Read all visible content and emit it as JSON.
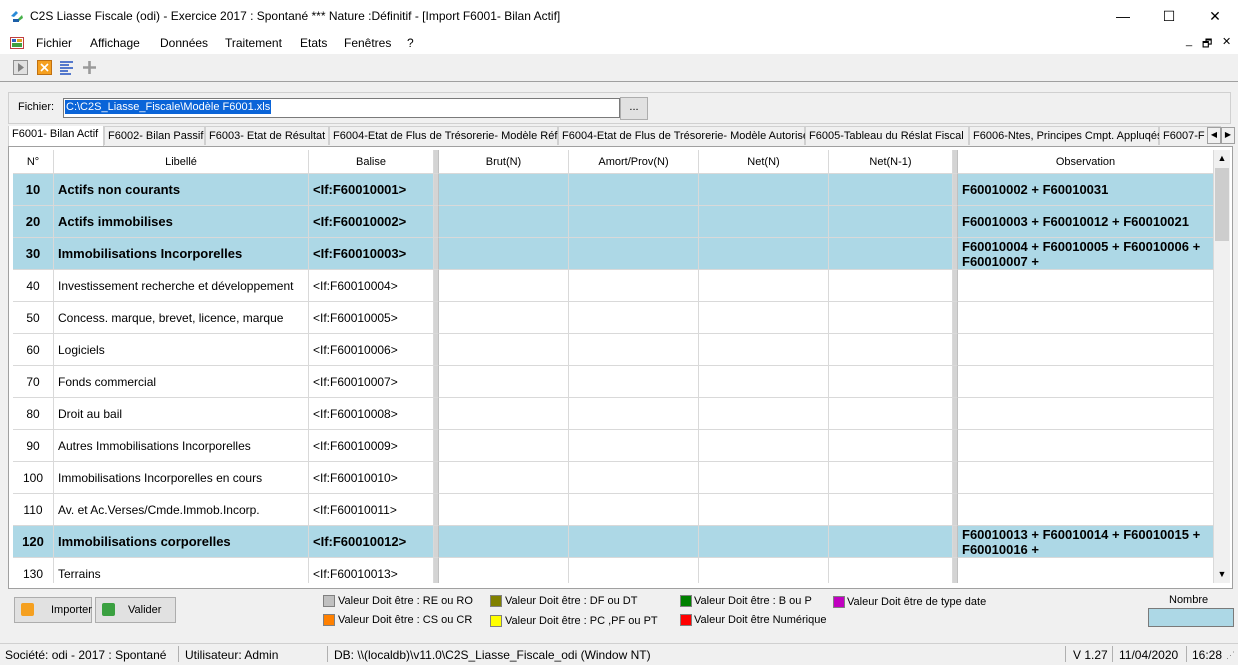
{
  "window": {
    "title": "C2S Liasse Fiscale (odi) - Exercice 2017 : Spontané *** Nature :Définitif - [Import F6001- Bilan Actif]",
    "minimize": "—",
    "maximize": "☐",
    "close": "✕"
  },
  "menu": {
    "items": [
      "Fichier",
      "Affichage",
      "Données",
      "Traitement",
      "Etats",
      "Fenêtres",
      "?"
    ],
    "mdi_minimize": "_",
    "mdi_restore": "🗗",
    "mdi_close": "✕"
  },
  "toolbar": {
    "icons": [
      "play-icon",
      "cancel-x-icon",
      "list-lines-icon",
      "plus-icon"
    ]
  },
  "file": {
    "label": "Fichier:",
    "value": "C:\\C2S_Liasse_Fiscale\\Modèle F6001.xls",
    "browse": "..."
  },
  "tabs": [
    {
      "label": "F6001- Bilan Actif",
      "active": true
    },
    {
      "label": "F6002- Bilan Passif"
    },
    {
      "label": "F6003- Etat de Résultat"
    },
    {
      "label": "F6004-Etat de Flus de Trésorerie- Modèle Réf"
    },
    {
      "label": "F6004-Etat de Flus de Trésorerie- Modèle Autorisé"
    },
    {
      "label": "F6005-Tableau du Réslat Fiscal"
    },
    {
      "label": "F6006-Ntes, Principes Cmpt. Appluqés"
    },
    {
      "label": "F6007-F"
    }
  ],
  "tab_scroll": {
    "left": "◀",
    "right": "▶"
  },
  "grid": {
    "headers": [
      "N°",
      "Libellé",
      "Balise",
      "Brut(N)",
      "Amort/Prov(N)",
      "Net(N)",
      "Net(N-1)",
      "Observation"
    ],
    "rows": [
      {
        "n": "10",
        "libelle": "Actifs non courants",
        "balise": "<If:F60010001>",
        "obs": "F60010002 + F60010031",
        "bold": true
      },
      {
        "n": "20",
        "libelle": "Actifs immobilises",
        "balise": "<If:F60010002>",
        "obs": "F60010003 + F60010012 + F60010021",
        "bold": true
      },
      {
        "n": "30",
        "libelle": "Immobilisations Incorporelles",
        "balise": "<If:F60010003>",
        "obs": "F60010004 + F60010005 + F60010006 + F60010007 +",
        "bold": true
      },
      {
        "n": "40",
        "libelle": "Investissement recherche et développement",
        "balise": "<If:F60010004>",
        "obs": "",
        "bold": false
      },
      {
        "n": "50",
        "libelle": "Concess.  marque, brevet, licence, marque",
        "balise": "<If:F60010005>",
        "obs": "",
        "bold": false
      },
      {
        "n": "60",
        "libelle": "Logiciels",
        "balise": "<If:F60010006>",
        "obs": "",
        "bold": false
      },
      {
        "n": "70",
        "libelle": "Fonds commercial",
        "balise": "<If:F60010007>",
        "obs": "",
        "bold": false
      },
      {
        "n": "80",
        "libelle": "Droit au bail",
        "balise": "<If:F60010008>",
        "obs": "",
        "bold": false
      },
      {
        "n": "90",
        "libelle": "Autres Immobilisations Incorporelles",
        "balise": "<If:F60010009>",
        "obs": "",
        "bold": false
      },
      {
        "n": "100",
        "libelle": "Immobilisations Incorporelles en cours",
        "balise": "<If:F60010010>",
        "obs": "",
        "bold": false
      },
      {
        "n": "110",
        "libelle": "Av. et Ac.Verses/Cmde.Immob.Incorp.",
        "balise": "<If:F60010011>",
        "obs": "",
        "bold": false
      },
      {
        "n": "120",
        "libelle": "Immobilisations corporelles",
        "balise": "<If:F60010012>",
        "obs": "F60010013 + F60010014 + F60010015 + F60010016 +",
        "bold": true
      },
      {
        "n": "130",
        "libelle": "Terrains",
        "balise": "<If:F60010013>",
        "obs": "",
        "bold": false
      }
    ],
    "scroll_up": "▲",
    "scroll_down": "▼"
  },
  "buttons": {
    "importer": "Importer",
    "valider": "Valider"
  },
  "legend": [
    {
      "text": "Valeur Doit être : RE ou RO",
      "color": "#c0c0c0"
    },
    {
      "text": "Valeur Doit être : CS ou CR",
      "color": "#ff8000"
    },
    {
      "text": "Valeur Doit être : DF ou DT",
      "color": "#808000"
    },
    {
      "text": "Valeur Doit être : PC ,PF ou  PT",
      "color": "#ffff00"
    },
    {
      "text": "Valeur Doit être : B ou P",
      "color": "#008000"
    },
    {
      "text": "Valeur Doit être Numérique",
      "color": "#ff0000"
    },
    {
      "text": "Valeur Doit être de type date",
      "color": "#c000c0"
    }
  ],
  "nombre": {
    "label": "Nombre",
    "value": ""
  },
  "status": {
    "societe": "Société: odi - 2017 : Spontané",
    "utilisateur": "Utilisateur: Admin",
    "db": "DB: \\\\(localdb)\\v11.0\\C2S_Liasse_Fiscale_odi (Window NT)",
    "version": "V 1.27",
    "date": "11/04/2020",
    "time": "16:28"
  },
  "colors": {
    "group_row": "#add8e6",
    "selection": "#0a64d8"
  }
}
